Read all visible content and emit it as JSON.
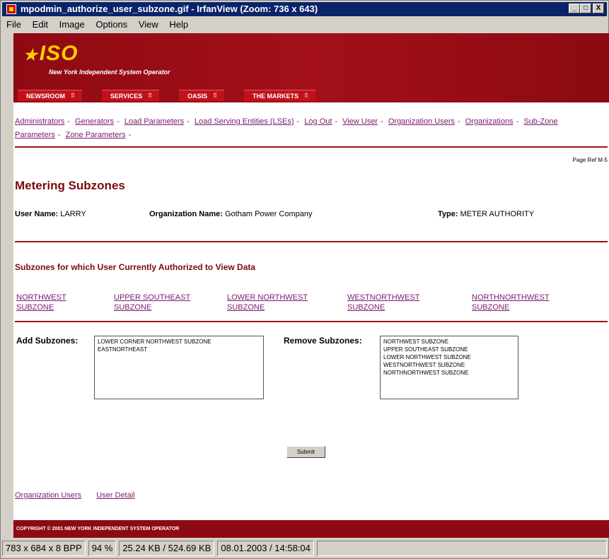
{
  "window": {
    "title": "mpodmin_authorize_user_subzone.gif - IrfanView (Zoom: 736 x 643)",
    "controls": {
      "minimize": "_",
      "maximize": "□",
      "close": "X"
    }
  },
  "menu": [
    "File",
    "Edit",
    "Image",
    "Options",
    "View",
    "Help"
  ],
  "banner": {
    "logo": "ISO",
    "tagline": "New York Independent System Operator",
    "tabs": [
      "NEWSROOM",
      "SERVICES",
      "OASIS",
      "THE MARKETS"
    ]
  },
  "nav_links": [
    "Administrators",
    "Generators",
    "Load Parameters",
    "Load Serving Entities (LSEs)",
    "Log Out",
    "View User",
    "Organization Users",
    "Organizations",
    "Sub-Zone Parameters",
    "Zone Parameters"
  ],
  "page_ref": "Page Ref M-5",
  "page_title": "Metering Subzones",
  "user_info": {
    "user_name_label": "User Name:",
    "user_name": "LARRY",
    "org_label": "Organization Name:",
    "org_name": "Gotham Power Company",
    "type_label": "Type:",
    "type_value": "METER AUTHORITY"
  },
  "authorized_heading": "Subzones for which User Currently Authorized to View Data",
  "authorized_subzones": [
    [
      "NORTHWEST",
      "SUBZONE"
    ],
    [
      "UPPER SOUTHEAST",
      "SUBZONE"
    ],
    [
      "LOWER NORTHWEST",
      "SUBZONE"
    ],
    [
      "WESTNORTHWEST",
      "SUBZONE"
    ],
    [
      "NORTHNORTHWEST",
      "SUBZONE"
    ]
  ],
  "add": {
    "label": "Add Subzones:",
    "options": [
      "LOWER CORNER NORTHWEST SUBZONE",
      "EASTNORTHEAST"
    ]
  },
  "remove": {
    "label": "Remove Subzones:",
    "options": [
      "NORTHWEST SUBZONE",
      "UPPER SOUTHEAST SUBZONE",
      "LOWER NORTHWEST SUBZONE",
      "WESTNORTHWEST SUBZONE",
      "NORTHNORTHWEST SUBZONE"
    ]
  },
  "submit_label": "Submit",
  "bottom_links": [
    "Organization Users",
    "User Detail"
  ],
  "footer": "COPYRIGHT © 2001 NEW YORK INDEPENDENT SYSTEM OPERATOR",
  "status": [
    "783 x 684 x 8 BPP",
    "94 %",
    "25.24 KB / 524.69 KB",
    "08.01.2003 / 14:58:04"
  ]
}
